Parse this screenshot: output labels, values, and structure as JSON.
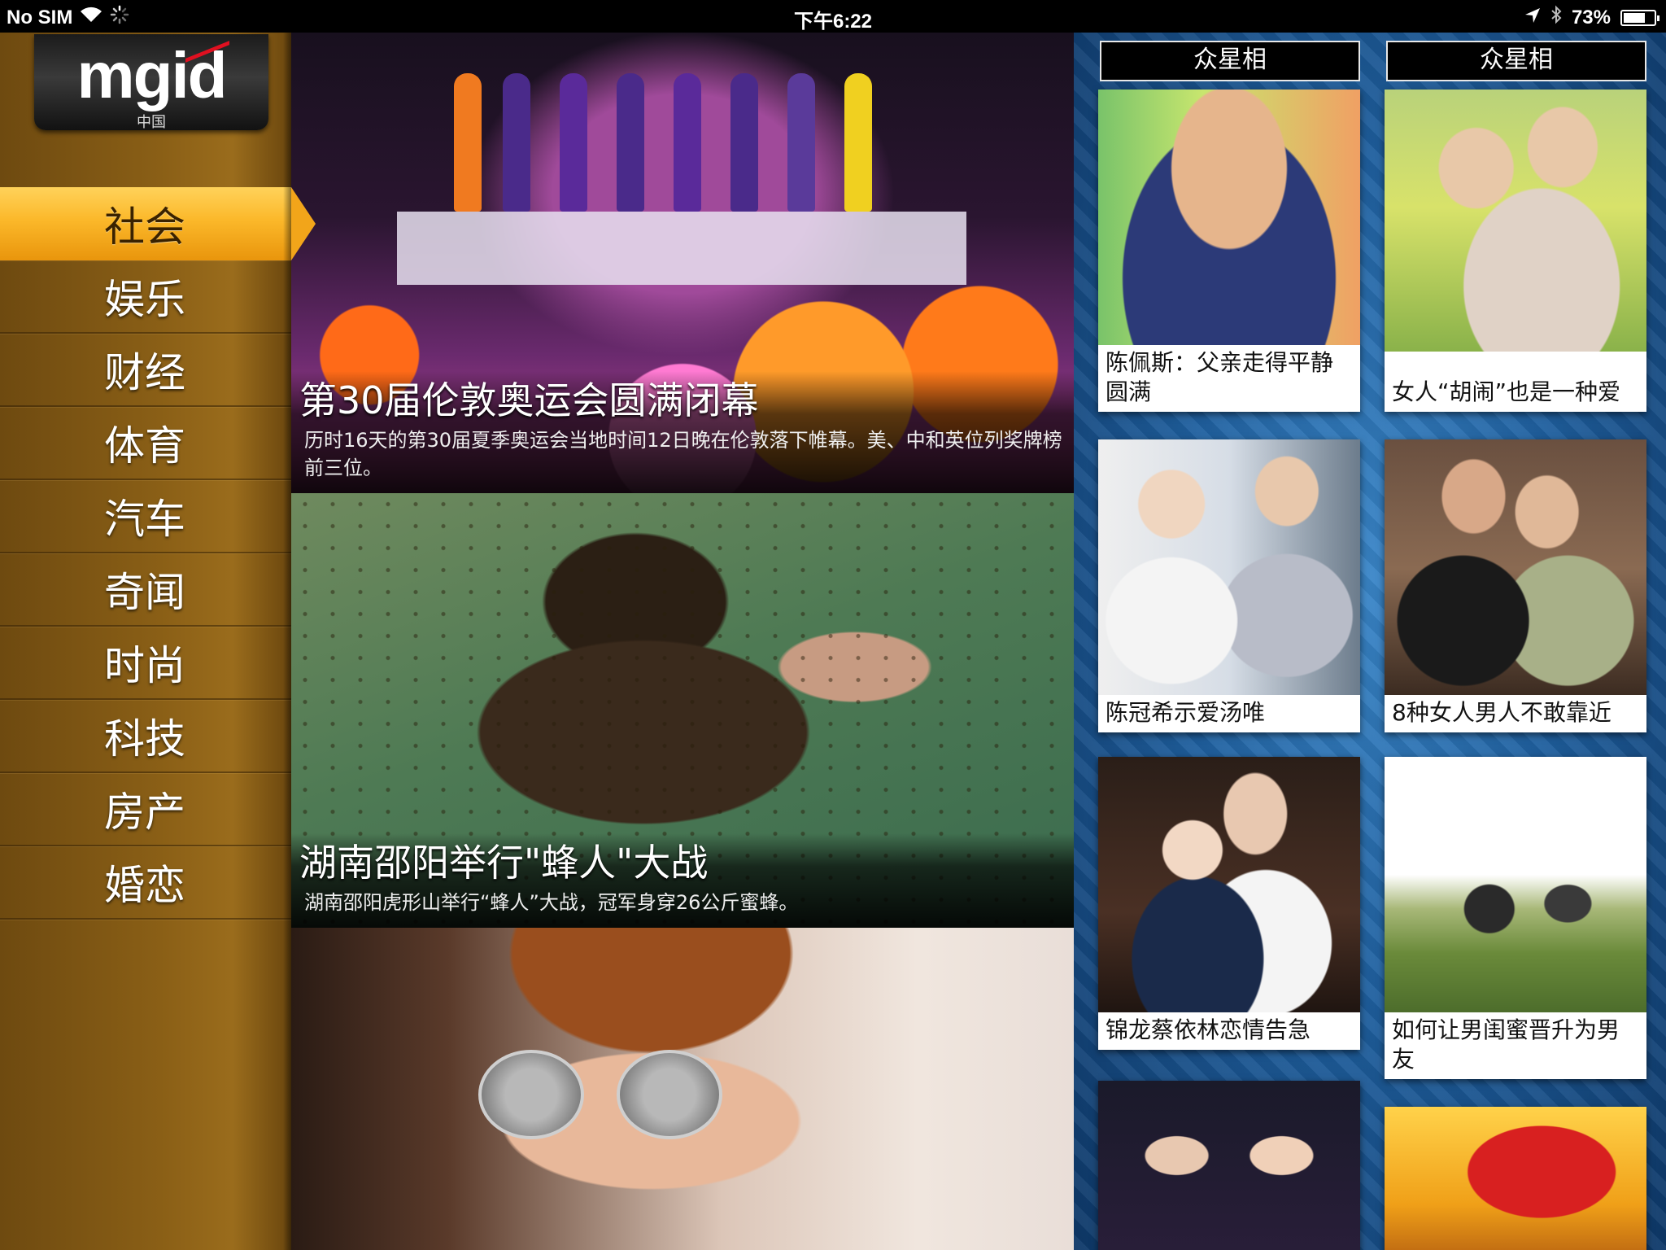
{
  "status_bar": {
    "carrier": "No SIM",
    "time": "下午6:22",
    "battery_percent": "73%",
    "battery_level": 0.73,
    "icons": [
      "wifi-icon",
      "activity-spinner-icon",
      "location-arrow-icon",
      "bluetooth-icon",
      "battery-icon"
    ]
  },
  "logo": {
    "main": "mgid",
    "sub": "中国"
  },
  "nav": {
    "items": [
      {
        "label": "社会",
        "active": true
      },
      {
        "label": "娱乐"
      },
      {
        "label": "财经"
      },
      {
        "label": "体育"
      },
      {
        "label": "汽车"
      },
      {
        "label": "奇闻"
      },
      {
        "label": "时尚"
      },
      {
        "label": "科技"
      },
      {
        "label": "房产"
      },
      {
        "label": "婚恋"
      }
    ]
  },
  "stories": [
    {
      "title": "第30届伦敦奥运会圆满闭幕",
      "summary": "历时16天的第30届夏季奥运会当地时间12日晚在伦敦落下帷幕。美、中和英位列奖牌榜前三位。"
    },
    {
      "title": "湖南邵阳举行\"蜂人\"大战",
      "summary": "湖南邵阳虎形山举行“蜂人”大战，冠军身穿26公斤蜜蜂。"
    },
    {
      "title": "",
      "summary": ""
    }
  ],
  "tiles": {
    "headers": [
      "众星相",
      "众星相"
    ],
    "left": [
      {
        "title": "陈佩斯：父亲走得平静圆满"
      },
      {
        "title": "陈冠希示爱汤唯"
      },
      {
        "title": "锦龙蔡依林恋情告急"
      },
      {
        "title": ""
      }
    ],
    "right": [
      {
        "title": "女人“胡闹”也是一种爱"
      },
      {
        "title": "8种女人男人不敢靠近"
      },
      {
        "title": "如何让男闺蜜晋升为男友"
      },
      {
        "title": ""
      }
    ]
  },
  "colors": {
    "nav_active": "#f6b02a",
    "sidebar": "#8a5f16",
    "tiles_bg": "#1f5f9e"
  }
}
